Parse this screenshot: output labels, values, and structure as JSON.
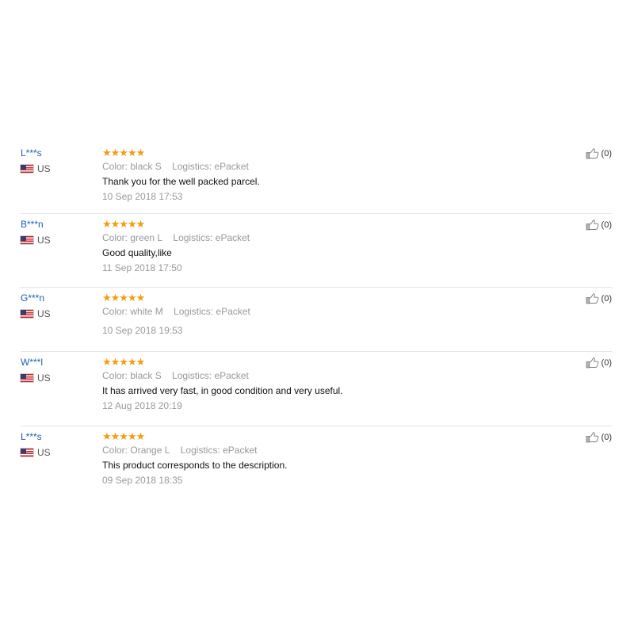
{
  "reviews": [
    {
      "user": "L***s",
      "country": "US",
      "stars": "★★★★★",
      "color_label": "Color:",
      "color_value": "black S",
      "logistics_label": "Logistics:",
      "logistics_value": "ePacket",
      "text": "Thank you for the well packed parcel.",
      "date": "10 Sep 2018 17:53",
      "helpful": "(0)"
    },
    {
      "user": "B***n",
      "country": "US",
      "stars": "★★★★★",
      "color_label": "Color:",
      "color_value": "green L",
      "logistics_label": "Logistics:",
      "logistics_value": "ePacket",
      "text": "Good quality,like",
      "date": "11 Sep 2018 17:50",
      "helpful": "(0)"
    },
    {
      "user": "G***n",
      "country": "US",
      "stars": "★★★★★",
      "color_label": "Color:",
      "color_value": "white M",
      "logistics_label": "Logistics:",
      "logistics_value": "ePacket",
      "text": "",
      "date": "10 Sep 2018 19:53",
      "helpful": "(0)"
    },
    {
      "user": "W***l",
      "country": "US",
      "stars": "★★★★★",
      "color_label": "Color:",
      "color_value": "black S",
      "logistics_label": "Logistics:",
      "logistics_value": "ePacket",
      "text": "It has arrived very fast, in good condition and very useful.",
      "date": "12 Aug 2018 20:19",
      "helpful": "(0)"
    },
    {
      "user": "L***s",
      "country": "US",
      "stars": "★★★★★",
      "color_label": "Color:",
      "color_value": "Orange L",
      "logistics_label": "Logistics:",
      "logistics_value": "ePacket",
      "text": "This product corresponds to the description.",
      "date": "09 Sep 2018 18:35",
      "helpful": "(0)"
    }
  ],
  "rating": 5,
  "colors": {
    "user_link": "#1a5fb4",
    "star": "#f39c12",
    "muted": "#999999"
  },
  "icons": {
    "flag": "us-flag-icon",
    "helpful": "thumbs-up-icon"
  }
}
